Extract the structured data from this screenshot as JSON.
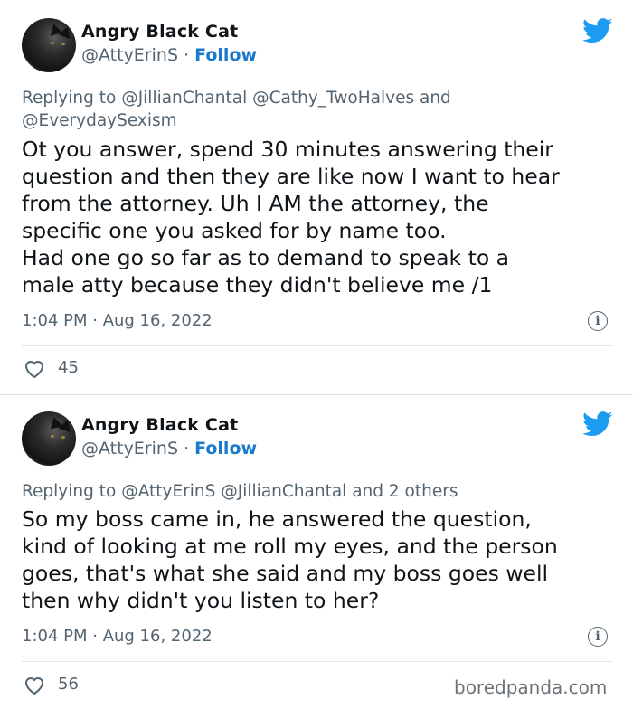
{
  "tweets": [
    {
      "author": {
        "name": "Angry Black Cat",
        "handle": "@AttyErinS",
        "separator": "·",
        "follow_label": "Follow"
      },
      "reply_to": {
        "prefix": "Replying to",
        "mentions": [
          "@JillianChantal",
          "@Cathy_TwoHalves"
        ],
        "joiner": "and",
        "mentions_line2": "@EverydaySexism"
      },
      "body_lines": [
        "Ot you answer, spend 30 minutes answering their",
        "question and then they are like now I want to hear",
        "from the attorney.  Uh I AM the attorney, the",
        "specific one you asked for by name too.",
        "Had one go so far as to demand to speak to a",
        "male atty because they didn't believe me /1"
      ],
      "timestamp": "1:04 PM · Aug 16, 2022",
      "likes": "45"
    },
    {
      "author": {
        "name": "Angry Black Cat",
        "handle": "@AttyErinS",
        "separator": "·",
        "follow_label": "Follow"
      },
      "reply_to": {
        "prefix": "Replying to",
        "mentions": [
          "@AttyErinS",
          "@JillianChantal"
        ],
        "joiner": "and 2 others"
      },
      "body_lines": [
        "So my boss came in, he answered the question,",
        "kind of looking at me roll my eyes, and the person",
        "goes, that's what she said and my boss goes well",
        "then why didn't you listen to her?"
      ],
      "timestamp": "1:04 PM · Aug 16, 2022",
      "likes": "56"
    }
  ],
  "watermark": "boredpanda.com",
  "icons": {
    "platform": "twitter-bird-icon",
    "info": "info-icon",
    "like": "heart-outline-icon"
  },
  "colors": {
    "accent": "#1d9bf0",
    "follow": "#1b7acc",
    "muted": "#536471",
    "text": "#0f1419"
  }
}
